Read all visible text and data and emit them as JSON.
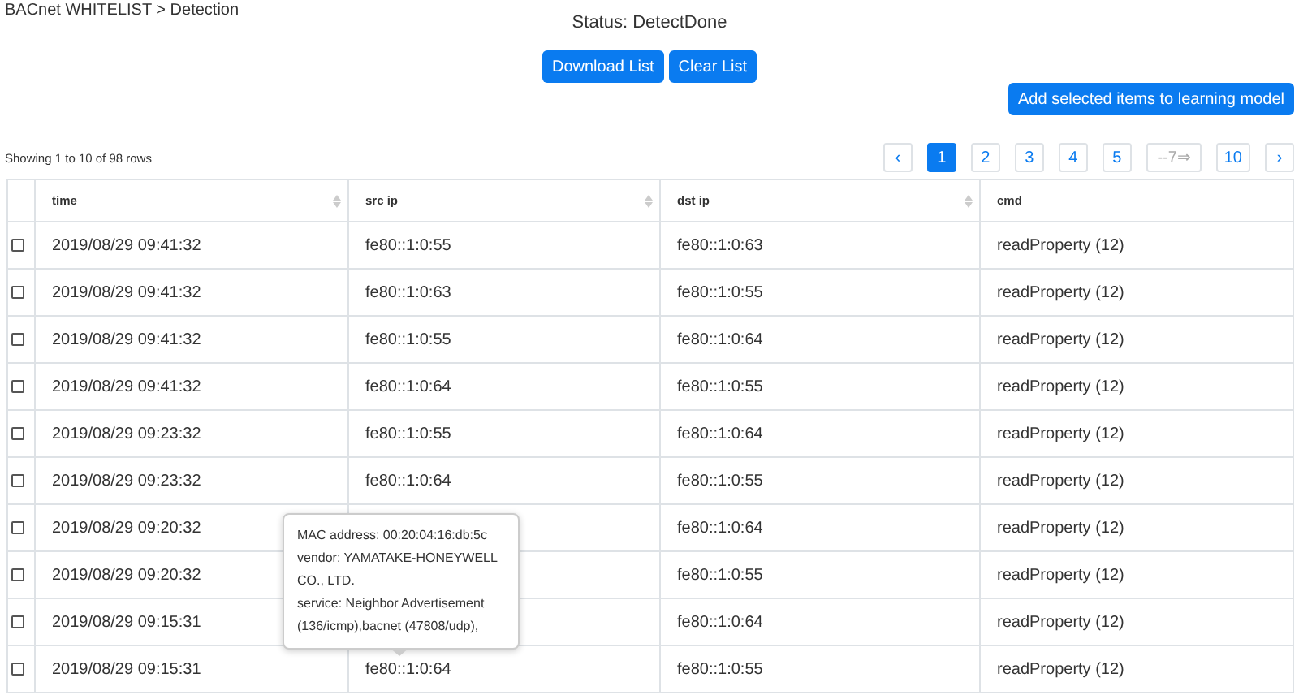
{
  "breadcrumb": "BACnet WHITELIST > Detection",
  "status": "Status: DetectDone",
  "buttons": [
    "Download List",
    "Clear List"
  ],
  "learn_button": "Add selected items to learning model",
  "rows_info": "Showing 1 to 10 of 98 rows",
  "pagination": [
    {
      "label": "‹",
      "selected": false,
      "disabled": false
    },
    {
      "label": "1",
      "selected": true,
      "disabled": false
    },
    {
      "label": "2",
      "selected": false,
      "disabled": false
    },
    {
      "label": "3",
      "selected": false,
      "disabled": false
    },
    {
      "label": "4",
      "selected": false,
      "disabled": false
    },
    {
      "label": "5",
      "selected": false,
      "disabled": false
    },
    {
      "label": "--7⇒",
      "selected": false,
      "disabled": true
    },
    {
      "label": "10",
      "selected": false,
      "disabled": false
    },
    {
      "label": "›",
      "selected": false,
      "disabled": false
    }
  ],
  "table": {
    "columns": [
      "time",
      "src ip",
      "dst ip",
      "cmd"
    ],
    "rows": [
      {
        "checked": false,
        "time": "2019/08/29 09:41:32",
        "src_ip": "fe80::1:0:55",
        "dst_ip": "fe80::1:0:63",
        "cmd": "readProperty (12)"
      },
      {
        "checked": false,
        "time": "2019/08/29 09:41:32",
        "src_ip": "fe80::1:0:63",
        "dst_ip": "fe80::1:0:55",
        "cmd": "readProperty (12)"
      },
      {
        "checked": false,
        "time": "2019/08/29 09:41:32",
        "src_ip": "fe80::1:0:55",
        "dst_ip": "fe80::1:0:64",
        "cmd": "readProperty (12)"
      },
      {
        "checked": false,
        "time": "2019/08/29 09:41:32",
        "src_ip": "fe80::1:0:64",
        "dst_ip": "fe80::1:0:55",
        "cmd": "readProperty (12)"
      },
      {
        "checked": false,
        "time": "2019/08/29 09:23:32",
        "src_ip": "fe80::1:0:55",
        "dst_ip": "fe80::1:0:64",
        "cmd": "readProperty (12)"
      },
      {
        "checked": false,
        "time": "2019/08/29 09:23:32",
        "src_ip": "fe80::1:0:64",
        "dst_ip": "fe80::1:0:55",
        "cmd": "readProperty (12)"
      },
      {
        "checked": false,
        "time": "2019/08/29 09:20:32",
        "dst_ip": "fe80::1:0:64",
        "cmd": "readProperty (12)"
      },
      {
        "checked": false,
        "time": "2019/08/29 09:20:32",
        "dst_ip": "fe80::1:0:55",
        "cmd": "readProperty (12)"
      },
      {
        "checked": false,
        "time": "2019/08/29 09:15:31",
        "dst_ip": "fe80::1:0:64",
        "cmd": "readProperty (12)"
      },
      {
        "checked": false,
        "time": "2019/08/29 09:15:31",
        "src_ip": "fe80::1:0:64",
        "dst_ip": "fe80::1:0:55",
        "cmd": "readProperty (12)"
      }
    ]
  },
  "tooltip": {
    "lines": [
      "MAC address: 00:20:04:16:db:5c",
      "vendor: YAMATAKE-HONEYWELL CO., LTD.",
      "service: Neighbor Advertisement (136/icmp),bacnet (47808/udp),"
    ]
  }
}
